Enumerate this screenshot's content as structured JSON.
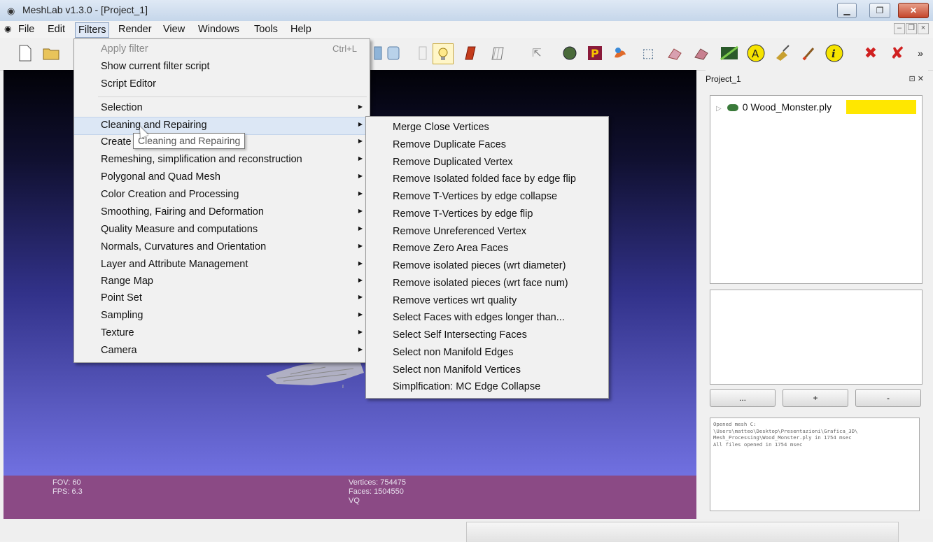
{
  "window": {
    "title": "MeshLab v1.3.0 - [Project_1]",
    "app_icon": "eye-icon",
    "controls": [
      "minimize-icon",
      "maximize-icon",
      "close-icon"
    ]
  },
  "menubar": {
    "items": [
      "File",
      "Edit",
      "Filters",
      "Render",
      "View",
      "Windows",
      "Tools",
      "Help"
    ],
    "active": "Filters"
  },
  "toolbar": {
    "icons": [
      "new-file-icon",
      "open-folder-icon",
      "flat-shading-icon",
      "light-bulb-icon",
      "color-mode-icon",
      "texture-icon",
      "select-icon",
      "sphere-icon",
      "photo-icon",
      "paint-icon",
      "select-faces-icon",
      "measure-icon",
      "align-icon",
      "texture-map-icon",
      "annotate-icon",
      "pick-points-icon",
      "brush-icon",
      "info-icon",
      "remove-icon",
      "remove-red-icon",
      "overflow-icon"
    ]
  },
  "filters_menu": {
    "items": [
      {
        "label": "Apply filter",
        "shortcut": "Ctrl+L",
        "disabled": true
      },
      {
        "label": "Show current filter script"
      },
      {
        "label": "Script Editor"
      },
      {
        "label": "Selection",
        "submenu": true
      },
      {
        "label": "Cleaning and Repairing",
        "submenu": true,
        "highlighted": true
      },
      {
        "label": "Create New Mesh Layer",
        "submenu": true
      },
      {
        "label": "Remeshing, simplification and reconstruction",
        "submenu": true
      },
      {
        "label": "Polygonal and Quad Mesh",
        "submenu": true
      },
      {
        "label": "Color Creation and Processing",
        "submenu": true
      },
      {
        "label": "Smoothing, Fairing and Deformation",
        "submenu": true
      },
      {
        "label": "Quality Measure and computations",
        "submenu": true
      },
      {
        "label": "Normals, Curvatures and Orientation",
        "submenu": true
      },
      {
        "label": "Layer and Attribute Management",
        "submenu": true
      },
      {
        "label": "Range Map",
        "submenu": true
      },
      {
        "label": "Point Set",
        "submenu": true
      },
      {
        "label": "Sampling",
        "submenu": true
      },
      {
        "label": "Texture",
        "submenu": true
      },
      {
        "label": "Camera",
        "submenu": true
      }
    ],
    "tooltip": "Cleaning and Repairing"
  },
  "submenu": {
    "items": [
      "Merge Close Vertices",
      "Remove Duplicate Faces",
      "Remove Duplicated Vertex",
      "Remove Isolated folded face by edge flip",
      "Remove T-Vertices by edge collapse",
      "Remove T-Vertices by edge flip",
      "Remove Unreferenced Vertex",
      "Remove Zero Area Faces",
      "Remove isolated pieces (wrt diameter)",
      "Remove isolated pieces (wrt face num)",
      "Remove vertices wrt quality",
      "Select Faces with edges longer than...",
      "Select Self Intersecting Faces",
      "Select non Manifold Edges",
      "Select non Manifold Vertices",
      "Simplfication: MC Edge Collapse"
    ]
  },
  "viewport": {
    "fov": "FOV: 60",
    "fps": "FPS:  6.3",
    "vertices": "Vertices: 754475",
    "faces": "Faces: 1504550",
    "vq": "VQ"
  },
  "panel": {
    "title": "Project_1",
    "layer": "0 Wood_Monster.ply",
    "buttons": [
      "...",
      "+",
      "-"
    ],
    "log": "Opened mesh C:\n\\Users\\matteo\\Desktop\\Presentazioni\\Grafica_3D\\\nMesh_Processing\\Wood_Monster.ply in 1754 msec\nAll files opened in 1754 msec"
  },
  "colors": {
    "infobar": "#8b4a85",
    "layer_highlight": "#ffe700",
    "menu_highlight": "#dce7f5"
  }
}
